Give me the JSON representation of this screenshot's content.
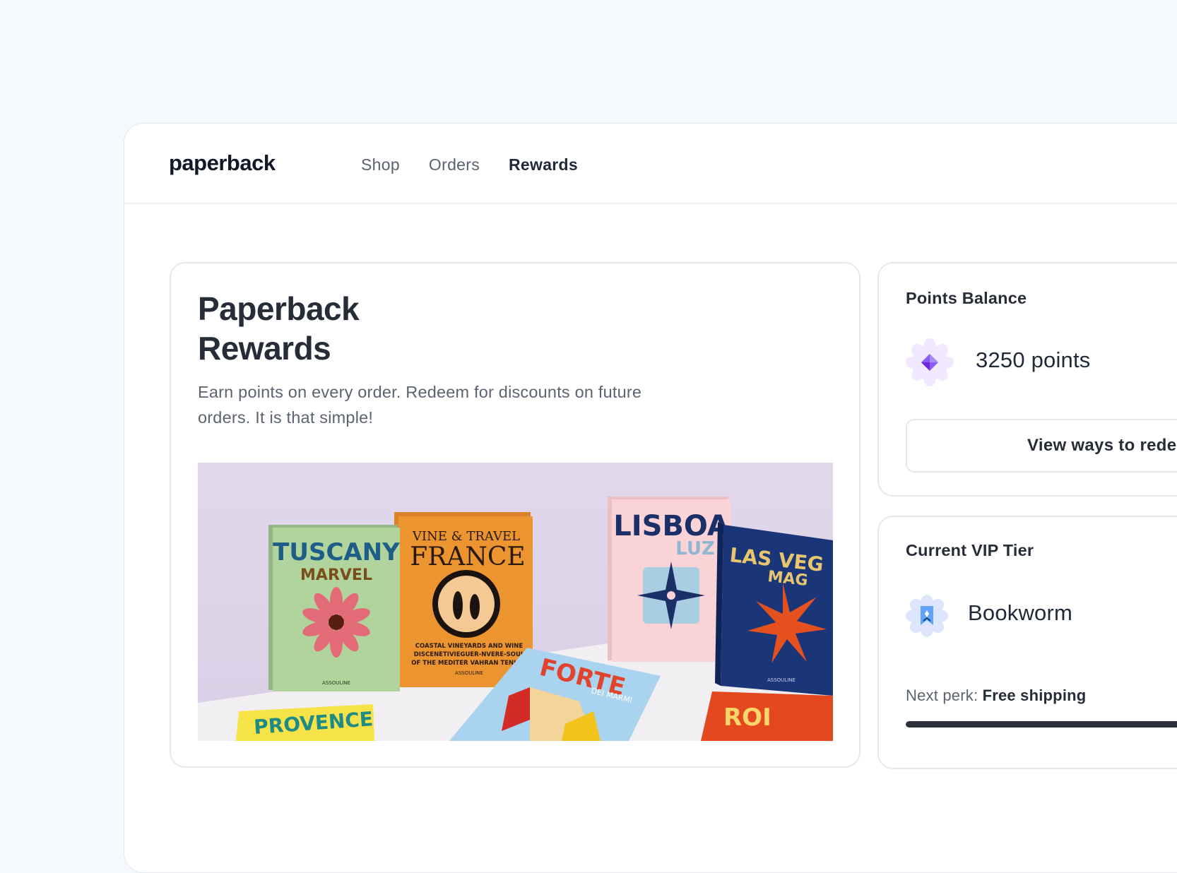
{
  "brand": {
    "name": "paperback"
  },
  "nav": {
    "items": [
      {
        "label": "Shop"
      },
      {
        "label": "Orders"
      },
      {
        "label": "Rewards"
      }
    ],
    "active": "Rewards"
  },
  "hero": {
    "title_line1": "Paperback",
    "title_line2": "Rewards",
    "description": "Earn points on every order. Redeem for discounts on future orders. It is that simple!",
    "image": {
      "books": [
        {
          "title": "TUSCANY",
          "subtitle": "MARVEL",
          "publisher": "ASSOULINE"
        },
        {
          "title": "FRANCE",
          "subtitle": "VINE & TRAVEL",
          "caption_line1": "COASTAL VINEYARDS AND WINE",
          "caption_line2": "DISCENETIVIEGUER-NVERE-SOUL",
          "caption_line3": "OF THE MEDITER VAHRAN TENUTE",
          "publisher": "ASSOULINE"
        },
        {
          "title": "LISBOA",
          "subtitle": "LUZ"
        },
        {
          "title": "LAS VEG",
          "subtitle": "MAG",
          "publisher": "ASSOULINE"
        },
        {
          "title": "FORTE",
          "subtitle": "DEI MARMI"
        },
        {
          "title": "PROVENCE"
        },
        {
          "title": "ROI"
        }
      ]
    }
  },
  "points": {
    "title": "Points Balance",
    "value": "3250 points",
    "button_label": "View ways to redeem",
    "icon": "diamond-icon"
  },
  "vip": {
    "title": "Current VIP Tier",
    "tier": "Bookworm",
    "icon": "bookmark-badge-icon",
    "next_perk_label": "Next perk:",
    "next_perk_value": "Free shipping",
    "progress": 1.0
  },
  "colors": {
    "accent_purple": "#8b5cf6",
    "accent_blue": "#60a5fa",
    "text_dark": "#262c38",
    "page_bg": "#f5f8fc"
  }
}
